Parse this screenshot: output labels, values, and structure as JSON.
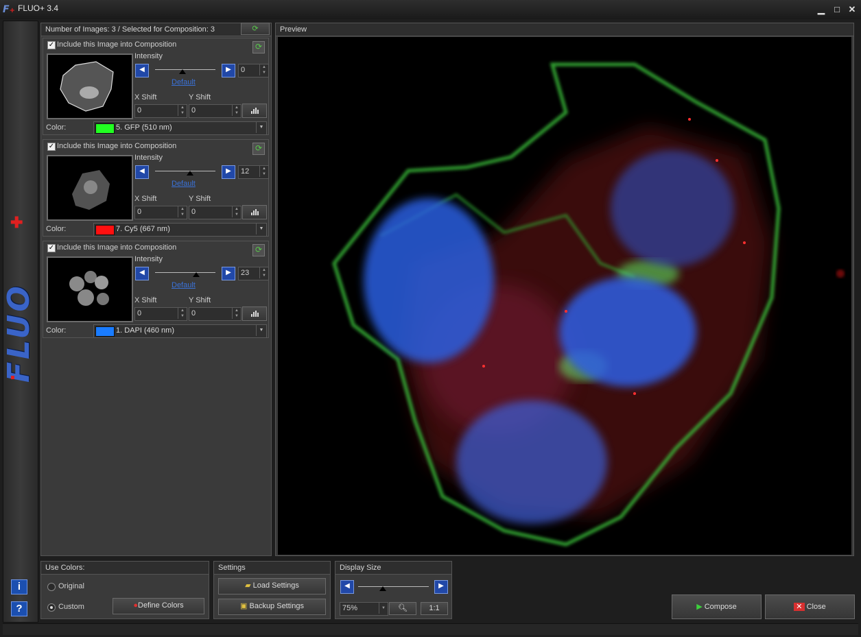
{
  "window": {
    "title": "FLUO+ 3.4",
    "minimize": "▁",
    "maximize": "□",
    "close": "✕"
  },
  "sidebar": {
    "logo_text": "FLUO",
    "info_label": "i",
    "help_label": "?"
  },
  "images_panel": {
    "header": "Number of Images: 3 / Selected for Composition: 3",
    "cards": [
      {
        "include_label": "Include this Image into Composition",
        "included": true,
        "intensity_label": "Intensity",
        "intensity_value": "0",
        "intensity_level": 0.45,
        "default_label": "Default",
        "xshift_label": "X Shift",
        "xshift_value": "0",
        "yshift_label": "Y Shift",
        "yshift_value": "0",
        "color_label": "Color:",
        "color_name": "5. GFP (510 nm)",
        "color_hex": "#22ff22",
        "thumb": "gfp"
      },
      {
        "include_label": "Include this Image into Composition",
        "included": true,
        "intensity_label": "Intensity",
        "intensity_value": "12",
        "intensity_level": 0.58,
        "default_label": "Default",
        "xshift_label": "X Shift",
        "xshift_value": "0",
        "yshift_label": "Y Shift",
        "yshift_value": "0",
        "color_label": "Color:",
        "color_name": "7. Cy5 (667 nm)",
        "color_hex": "#ff1010",
        "thumb": "cy5"
      },
      {
        "include_label": "Include this Image into Composition",
        "included": true,
        "intensity_label": "Intensity",
        "intensity_value": "23",
        "intensity_level": 0.68,
        "default_label": "Default",
        "xshift_label": "X Shift",
        "xshift_value": "0",
        "yshift_label": "Y Shift",
        "yshift_value": "0",
        "color_label": "Color:",
        "color_name": "1. DAPI (460 nm)",
        "color_hex": "#1a7cff",
        "thumb": "dapi"
      }
    ]
  },
  "preview": {
    "header": "Preview"
  },
  "use_colors": {
    "header": "Use Colors:",
    "original_label": "Original",
    "custom_label": "Custom",
    "selected": "custom",
    "define_colors_label": "Define Colors"
  },
  "settings": {
    "header": "Settings",
    "load_label": "Load Settings",
    "backup_label": "Backup Settings"
  },
  "display_size": {
    "header": "Display Size",
    "zoom_value": "75%",
    "zoom_level": 0.35,
    "one_to_one_label": "1:1"
  },
  "actions": {
    "compose_label": "Compose",
    "close_label": "Close"
  }
}
